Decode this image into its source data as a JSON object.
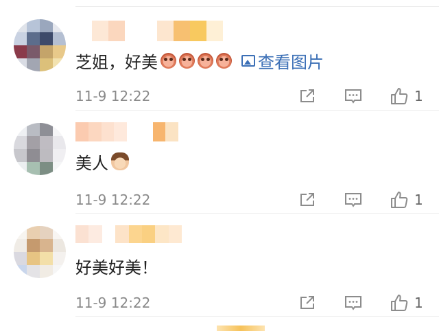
{
  "comments": [
    {
      "text": "芝姐，好美",
      "emoji_count": 4,
      "view_image": "查看图片",
      "time": "11-9 12:22",
      "likes": "1",
      "avatar_colors": [
        "#dfe3ea",
        "#b7c4d8",
        "#9aa7bd",
        "#e6e8ee",
        "#c9d2e2",
        "#5c6d8c",
        "#3d4a6a",
        "#b4bfd2",
        "#8a3a4a",
        "#7a5a6a",
        "#c4a46a",
        "#e8c98a",
        "#d9dce4",
        "#a2a6b2",
        "#dcc07a",
        "#f2e2b0"
      ],
      "name_colors": [
        "#ffffff",
        "#fde8d6",
        "#fbd7be",
        "#ffffff",
        "#ffffff",
        "#fde6cf",
        "#f7c071",
        "#f8c95f",
        "#fef0d6"
      ]
    },
    {
      "text": "美人",
      "time": "11-9 12:22",
      "likes": "1",
      "avatar_colors": [
        "#eef0f3",
        "#b9bcc3",
        "#8e8f96",
        "#f5f5f7",
        "#d9d9de",
        "#a3a0a6",
        "#bfbcc2",
        "#e9e8ec",
        "#c7c7cc",
        "#8f8d93",
        "#bdbbc0",
        "#f0eff2",
        "#eceff1",
        "#a7bfb1",
        "#7c8e84",
        "#f4f5f6"
      ],
      "name_colors": [
        "#fbcbb0",
        "#fcd7c0",
        "#fde1cf",
        "#fee9dc",
        "#ffffff",
        "#ffffff",
        "#f7b56e",
        "#fbe3c3"
      ]
    },
    {
      "text": "好美好美！",
      "time": "11-9 12:22",
      "likes": "1",
      "avatar_colors": [
        "#f7f4ef",
        "#e9cfb0",
        "#e5d2bf",
        "#f8f5f2",
        "#f0ece6",
        "#c59a6e",
        "#d8b48e",
        "#ece7e0",
        "#dad9e0",
        "#e7c483",
        "#f3dfa8",
        "#f4f1ee",
        "#c9d6ec",
        "#e4e3e6",
        "#f1ece4",
        "#f6f6f6"
      ],
      "name_colors": [
        "#fbe1d2",
        "#fdebe1",
        "#ffffff",
        "#fde3c8",
        "#fcd58f",
        "#fad082",
        "#fde6c6",
        "#fee9d2"
      ]
    }
  ],
  "colors": {
    "link": "#3b6fb6",
    "time": "#8a8a8a",
    "icon": "#8c8c8c"
  }
}
